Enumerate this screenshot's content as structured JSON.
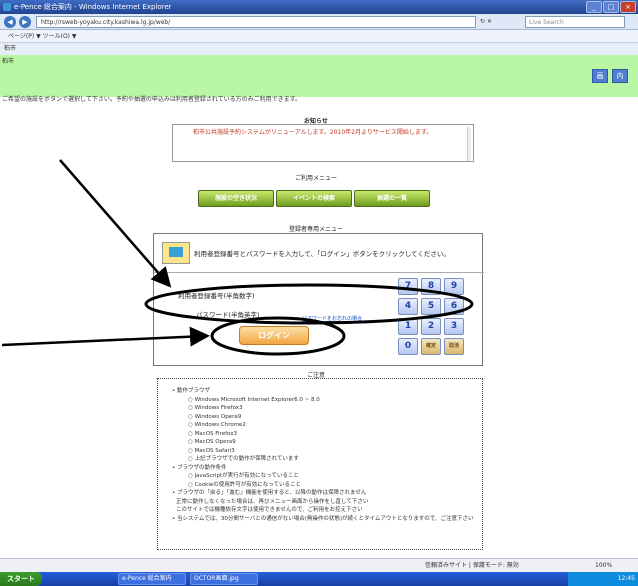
{
  "window": {
    "title": "e-Pence 総合案内 - Windows Internet Explorer",
    "buttons": [
      "_",
      "□",
      "×"
    ]
  },
  "browser": {
    "url": "http://rsweb-yoyaku.city.kashiwa.lg.jp/web/",
    "search_placeholder": "Live Search",
    "command_bar": "ページ(P) ▼  ツール(O) ▼",
    "tab": "柏市"
  },
  "banner": {
    "site_title": "柏市",
    "control_labels": [
      "画",
      "内"
    ]
  },
  "instructions": "ご希望の施設をボタンで選択して下さい。予約や抽選の申込みは利用者登録されている方のみご利用できます。",
  "notice": {
    "heading": "お知らせ",
    "text": "柏市公共施設予約システムがリニューアルします。2010年2月よりサービス開始します。"
  },
  "menu": {
    "heading": "ご利用メニュー",
    "buttons": [
      "施設の空き状況",
      "イベントの検索",
      "抽選の一覧"
    ]
  },
  "registered": {
    "heading": "登録者専用メニュー",
    "message": "利用者登録番号とパスワードを入力して、「ログイン」ボタンをクリックしてください。",
    "id_label": "利用者登録番号(半角数字)",
    "password_label": "パスワード(半角英字)",
    "forgot_link": "パスワードをお忘れの場合",
    "login_label": "ログイン",
    "keypad": [
      "7",
      "8",
      "9",
      "4",
      "5",
      "6",
      "1",
      "2",
      "3",
      "0",
      "確定",
      "取消"
    ]
  },
  "notes": {
    "heading": "ご注意",
    "items": [
      {
        "t": "動作ブラウザ",
        "k": "b"
      },
      {
        "t": "Windows Microsoft Internet Explorer6.0 ~ 8.0",
        "k": "s"
      },
      {
        "t": "Windows Firefox3",
        "k": "s"
      },
      {
        "t": "Windows Opera9",
        "k": "s"
      },
      {
        "t": "Windows Chrome2",
        "k": "s"
      },
      {
        "t": "MacOS Firefox3",
        "k": "s"
      },
      {
        "t": "MacOS Opera9",
        "k": "s"
      },
      {
        "t": "MacOS Safari3",
        "k": "s"
      },
      {
        "t": "上記ブラウザでの動作が保障されています",
        "k": "s"
      },
      {
        "t": "ブラウザの動作条件",
        "k": "b"
      },
      {
        "t": "JavaScriptが実行が有効になっていること",
        "k": "s"
      },
      {
        "t": "Cookieの使用許可が有効になっていること",
        "k": "s"
      },
      {
        "t": "ブラウザの「戻る」「進む」機能を使用すると、以降の動作は保障されません",
        "k": "b"
      },
      {
        "t": "正常に動作しなくなった場合は、再びメニュー画面から操作をし直して下さい",
        "k": "c"
      },
      {
        "t": "このサイトでは機種依存文字は使用できませんので、ご利用をお控え下さい",
        "k": "c"
      },
      {
        "t": "当システムでは、30分間サーバとの通信がない場合(無操作の状態)が続くとタイムアウトとなりますので、ご注意下さい",
        "k": "b"
      }
    ]
  },
  "status": {
    "zone": "信頼済みサイト | 保護モード: 無効",
    "zoom": "100%"
  },
  "taskbar": {
    "start": "スタート",
    "tasks": [
      "e-Pence 総合案内",
      "OCTOR画面.jpg"
    ],
    "clock": "12:45"
  }
}
